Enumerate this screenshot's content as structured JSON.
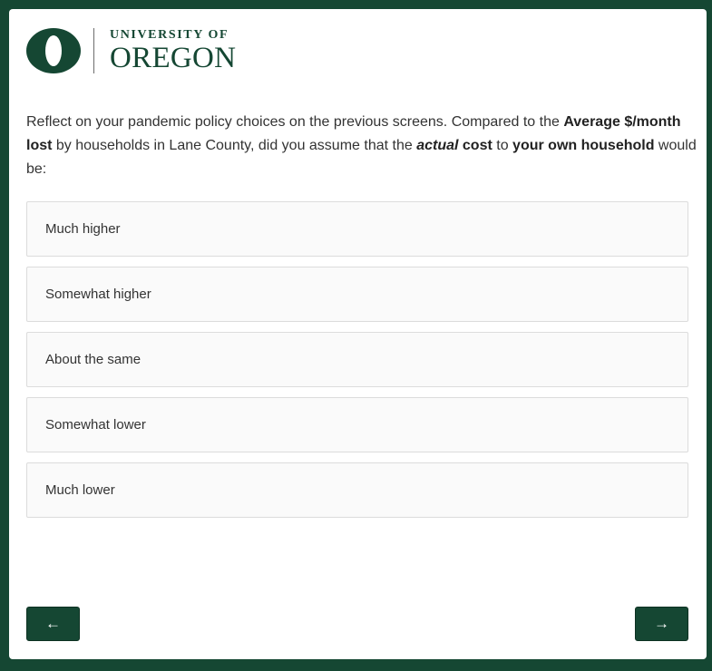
{
  "logo": {
    "line1": "UNIVERSITY OF",
    "line2": "OREGON",
    "brand_color": "#154733"
  },
  "question": {
    "part1": "Reflect on your pandemic policy choices on the previous screens. Compared to the ",
    "bold1": "Average $/month lost",
    "part2": " by households in Lane County, did you assume that the ",
    "bolditalic": "actual",
    "part3": " ",
    "bold2": "cost",
    "part4": " to ",
    "bold3": "your own household",
    "part5": " would be:"
  },
  "options": [
    {
      "label": "Much higher"
    },
    {
      "label": "Somewhat higher"
    },
    {
      "label": "About the same"
    },
    {
      "label": "Somewhat lower"
    },
    {
      "label": "Much lower"
    }
  ],
  "nav": {
    "back_icon": "left-arrow-icon",
    "back_label": "←",
    "next_icon": "right-arrow-icon",
    "next_label": "→"
  }
}
